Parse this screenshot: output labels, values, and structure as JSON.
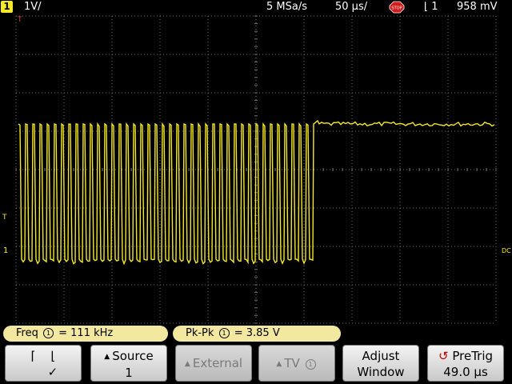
{
  "top_bar": {
    "channel_badge": "1",
    "channel_scale": "1V/",
    "sample_rate": "5 MSa/s",
    "timebase": "50 µs/",
    "run_state_icon": "stop-icon",
    "run_state_label": "STOP",
    "trigger_slope_icon": "falling-edge-icon",
    "trigger_channel": "1",
    "trigger_level": "958 mV"
  },
  "markers": {
    "channel_ground": "1",
    "trigger_level_marker": "T",
    "trigger_time_marker": "T",
    "dc_marker": "DC"
  },
  "measurements": {
    "freq_label": "Freq",
    "freq_channel": "1",
    "freq_value": "= 111 kHz",
    "pkpk_label": "Pk-Pk",
    "pkpk_channel": "1",
    "pkpk_value": "= 3.85 V"
  },
  "softkeys": {
    "source_label": "Source",
    "source_value": "1",
    "external_label": "External",
    "tv_label": "TV",
    "tv_channel": "1",
    "adjust_label1": "Adjust",
    "adjust_label2": "Window",
    "pretrig_label": "PreTrig",
    "pretrig_value": "49.0 µs"
  },
  "colors": {
    "trace": "#f5e82a",
    "grid": "#6e6e6e",
    "meas_bg": "#f2e8a0"
  }
}
